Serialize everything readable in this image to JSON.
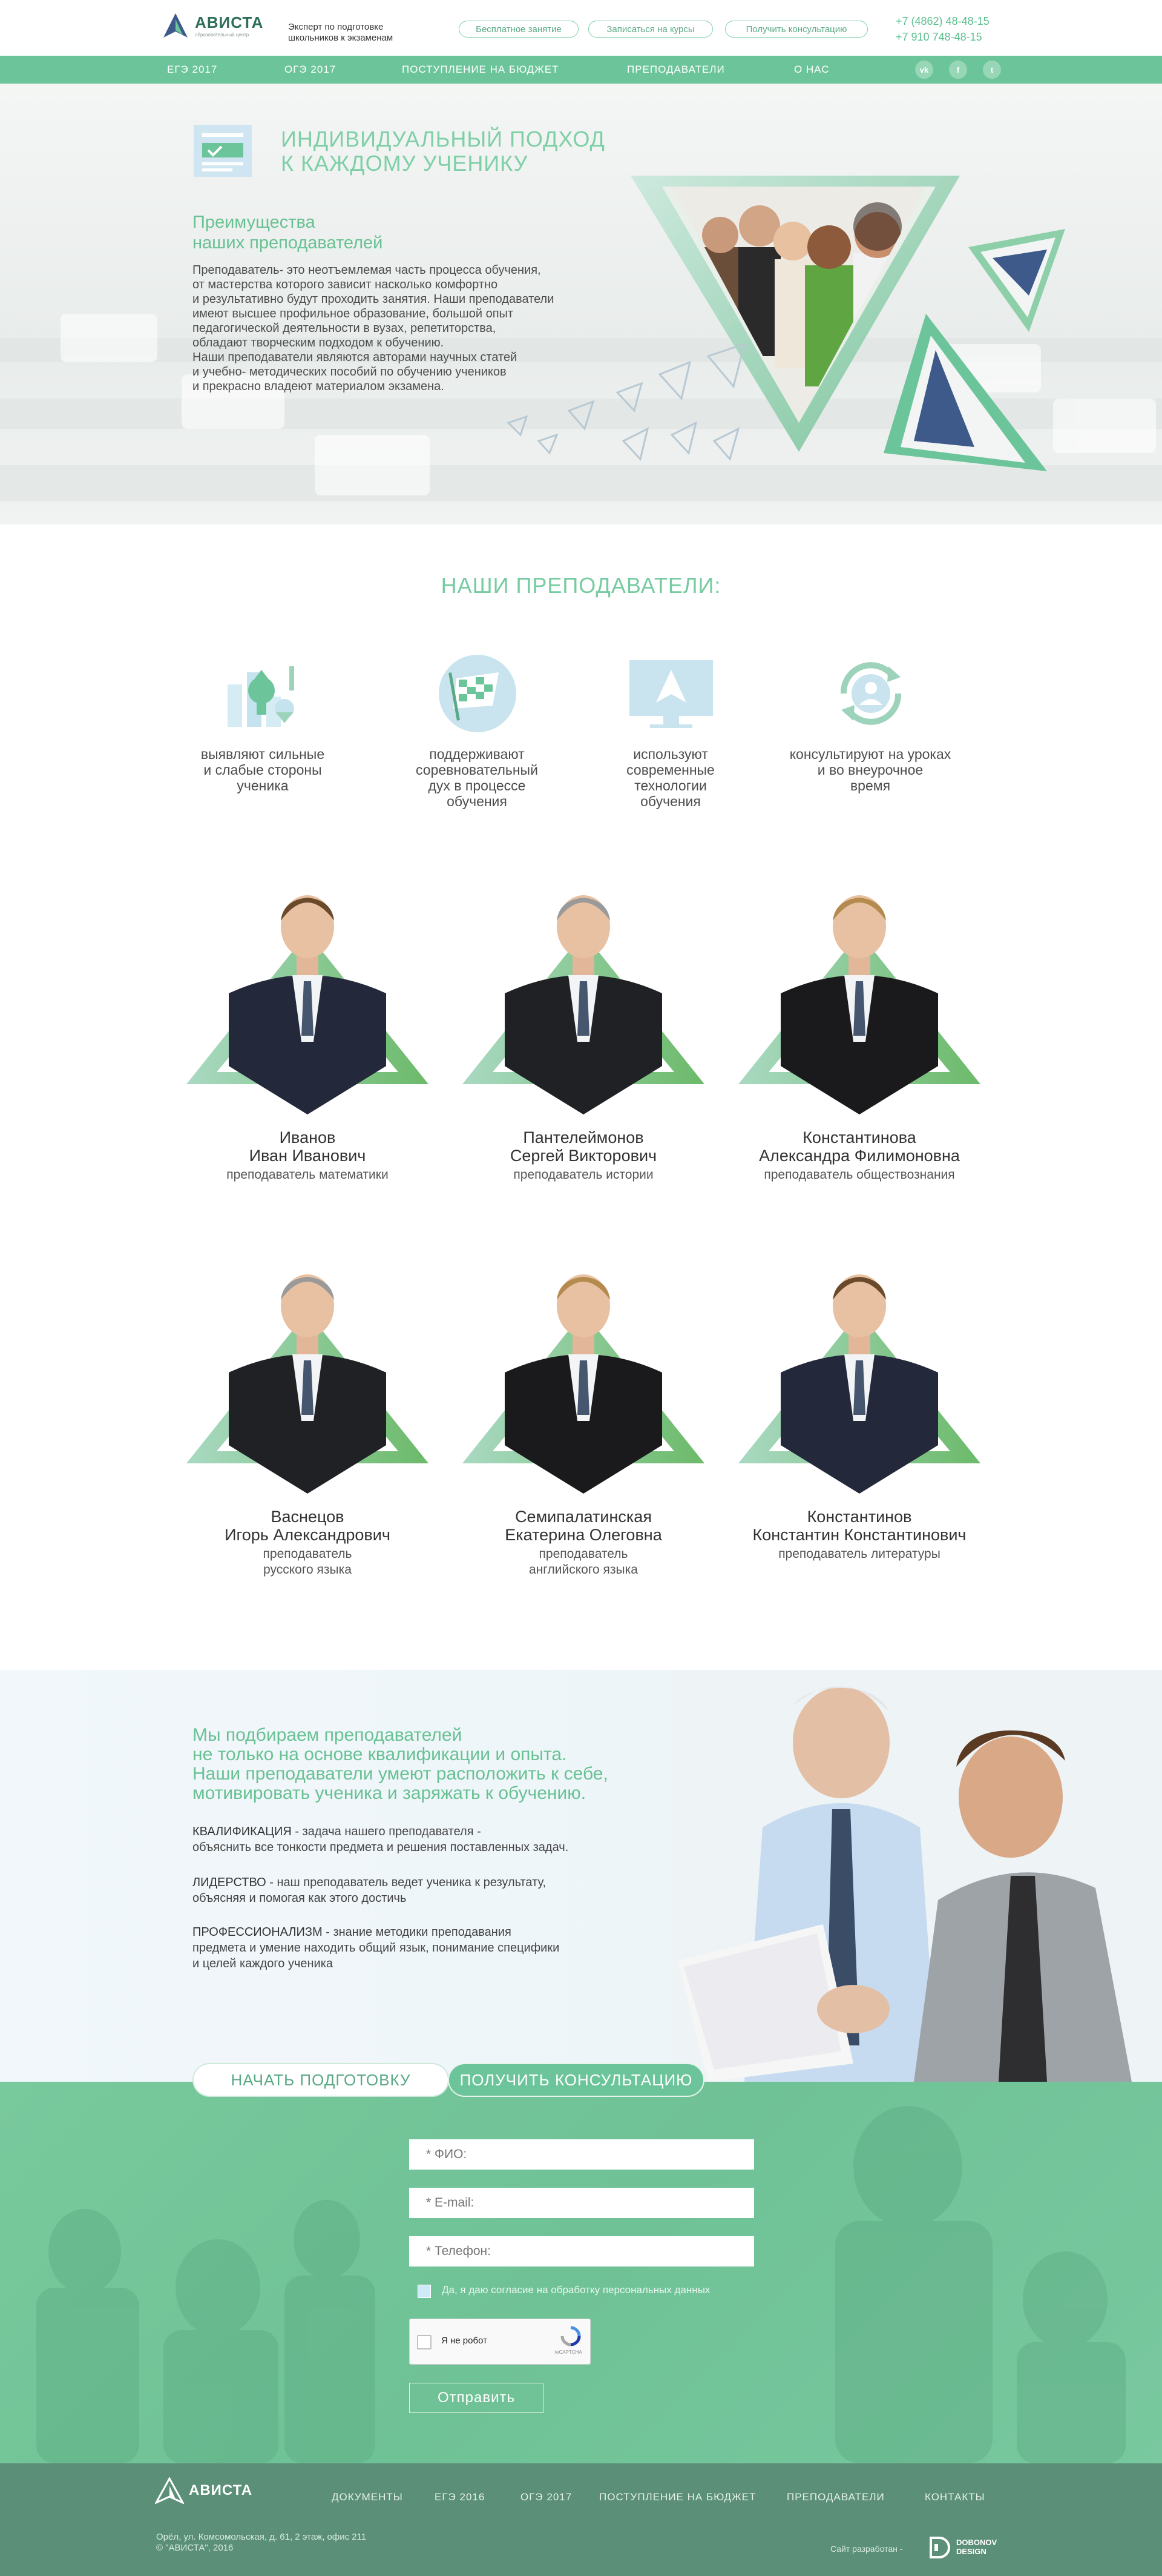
{
  "header": {
    "logo_name": "АВИСТА",
    "logo_sub": "образовательный центр",
    "tagline": "Эксперт по подготовке школьников к экзаменам",
    "buttons": [
      "Бесплатное занятие",
      "Записаться на курсы",
      "Получить консультацию"
    ],
    "phones": [
      "+7 (4862) 48-48-15",
      "+7 910 748-48-15"
    ]
  },
  "nav": {
    "items": [
      "ЕГЭ 2017",
      "ОГЭ 2017",
      "ПОСТУПЛЕНИЕ НА БЮДЖЕТ",
      "ПРЕПОДАВАТЕЛИ",
      "О НАС"
    ],
    "social": [
      "vk",
      "f",
      "t"
    ]
  },
  "hero": {
    "title_line1": "ИНДИВИДУАЛЬНЫЙ ПОДХОД",
    "title_line2": "К КАЖДОМУ УЧЕНИКУ",
    "sub_line1": "Преимущества",
    "sub_line2": "наших преподавателей",
    "para": [
      "Преподаватель- это неотъемлемая часть процесса обучения,",
      "от мастерства которого зависит насколько комфортно",
      "и результативно будут проходить занятия. Наши преподаватели",
      "имеют высшее профильное образование, большой опыт",
      "педагогической деятельности в вузах, репетиторства,",
      "обладают творческим подходом к обучению.",
      "Наши преподаватели являются авторами научных статей",
      "и учебно- методических пособий по обучению учеников",
      "и прекрасно владеют материалом экзамена."
    ]
  },
  "teachers_section": {
    "title": "НАШИ ПРЕПОДАВАТЕЛИ:",
    "features": [
      {
        "icon": "growth-chart-icon",
        "lines": [
          "выявляют сильные",
          "и слабые стороны",
          "ученика"
        ]
      },
      {
        "icon": "checkered-flag-icon",
        "lines": [
          "поддерживают",
          "соревновательный",
          "дух в процессе",
          "обучения"
        ]
      },
      {
        "icon": "monitor-icon",
        "lines": [
          "используют",
          "современные",
          "технологии",
          "обучения"
        ]
      },
      {
        "icon": "user-refresh-icon",
        "lines": [
          "консультируют на уроках",
          "и во внеурочное",
          "время"
        ]
      }
    ],
    "teachers": [
      {
        "name1": "Иванов",
        "name2": "Иван Иванович",
        "role": [
          "преподаватель математики"
        ]
      },
      {
        "name1": "Пантелеймонов",
        "name2": "Сергей Викторович",
        "role": [
          "преподаватель истории"
        ]
      },
      {
        "name1": "Константинова",
        "name2": "Александра Филимоновна",
        "role": [
          "преподаватель обществознания"
        ]
      },
      {
        "name1": "Васнецов",
        "name2": "Игорь Александрович",
        "role": [
          "преподаватель",
          "русского языка"
        ]
      },
      {
        "name1": "Семипалатинская",
        "name2": "Екатерина Олеговна",
        "role": [
          "преподаватель",
          "английского языка"
        ]
      },
      {
        "name1": "Константинов",
        "name2": "Константин Константинович",
        "role": [
          "преподаватель литературы"
        ]
      }
    ]
  },
  "quality": {
    "lead": [
      "Мы подбираем преподавателей",
      "не только на основе квалификации и опыта.",
      "Наши преподаватели умеют расположить к себе,",
      "мотивировать ученика и заряжать к обучению."
    ],
    "items": [
      {
        "key": "КВАЛИФИКАЦИЯ",
        "lines": [
          " - задача нашего преподавателя -",
          "объяснить все тонкости предмета и решения поставленных задач."
        ]
      },
      {
        "key": "ЛИДЕРСТВО",
        "lines": [
          " -  наш преподаватель ведет ученика к результату,",
          "объясняя и помогая как этого достичь"
        ]
      },
      {
        "key": "ПРОФЕССИОНАЛИЗМ",
        "lines": [
          " - знание методики преподавания",
          "предмета и умение находить общий язык, понимание специфики",
          "и целей каждого ученика"
        ]
      }
    ]
  },
  "form": {
    "tab_start": "НАЧАТЬ ПОДГОТОВКУ",
    "tab_consult": "ПОЛУЧИТЬ КОНСУЛЬТАЦИЮ",
    "name_placeholder": "* ФИО:",
    "email_placeholder": "* E-mail:",
    "phone_placeholder": "* Телефон:",
    "consent": "Да, я даю согласие на обработку персональных данных",
    "captcha_label": "Я не робот",
    "captcha_brand": "reCAPTCHA",
    "submit": "Отправить"
  },
  "footer": {
    "logo_name": "АВИСТА",
    "links": [
      "ДОКУМЕНТЫ",
      "ЕГЭ 2016",
      "ОГЭ 2017",
      "ПОСТУПЛЕНИЕ НА БЮДЖЕТ",
      "ПРЕПОДАВАТЕЛИ",
      "КОНТАКТЫ"
    ],
    "address1": "Орёл, ул. Комсомольская, д. 61, 2 этаж, офис 211",
    "address2": "© \"АВИСТА\", 2016",
    "dev_label": "Сайт разработан -",
    "dev_name1": "DOBONOV",
    "dev_name2": "DESIGN"
  },
  "colors": {
    "accent": "#6cc59a",
    "accent_text": "#68c193",
    "footer": "#5b8f78",
    "dark_blue": "#3d5a8a"
  }
}
